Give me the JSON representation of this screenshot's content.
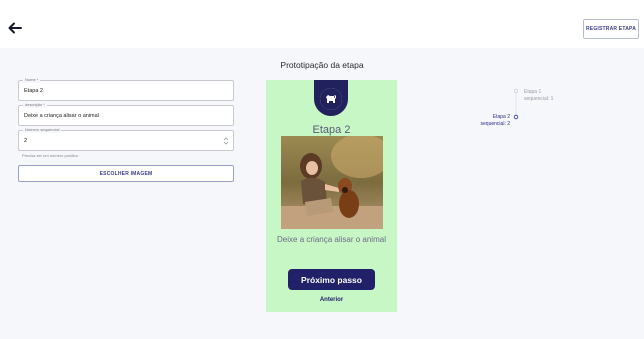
{
  "header": {
    "register_label": "REGISTRAR ETAPA"
  },
  "section_title": "Prototipação da etapa",
  "form": {
    "name": {
      "label": "Nome *",
      "value": "Etapa 2"
    },
    "description": {
      "label": "descrição *",
      "value": "Deixe a criança alisar o animal"
    },
    "sequence": {
      "label": "Número sequencial",
      "value": "2"
    },
    "helper": "Precisa ser um número positivo",
    "choose_image_label": "ESCOLHER IMAGEM"
  },
  "preview": {
    "title": "Etapa 2",
    "description": "Deixe a criança alisar o animal",
    "next_label": "Próximo passo",
    "prev_label": "Anterior",
    "colors": {
      "background": "#c7f7c4",
      "brand": "#21216a"
    }
  },
  "timeline": {
    "items": [
      {
        "title": "Etapa 1",
        "subtitle": "sequencial: 1",
        "active": false
      },
      {
        "title": "Etapa 2",
        "subtitle": "sequencial: 2",
        "active": true
      }
    ]
  },
  "icons": {
    "back": "back-arrow-icon",
    "logo": "dog-icon"
  }
}
